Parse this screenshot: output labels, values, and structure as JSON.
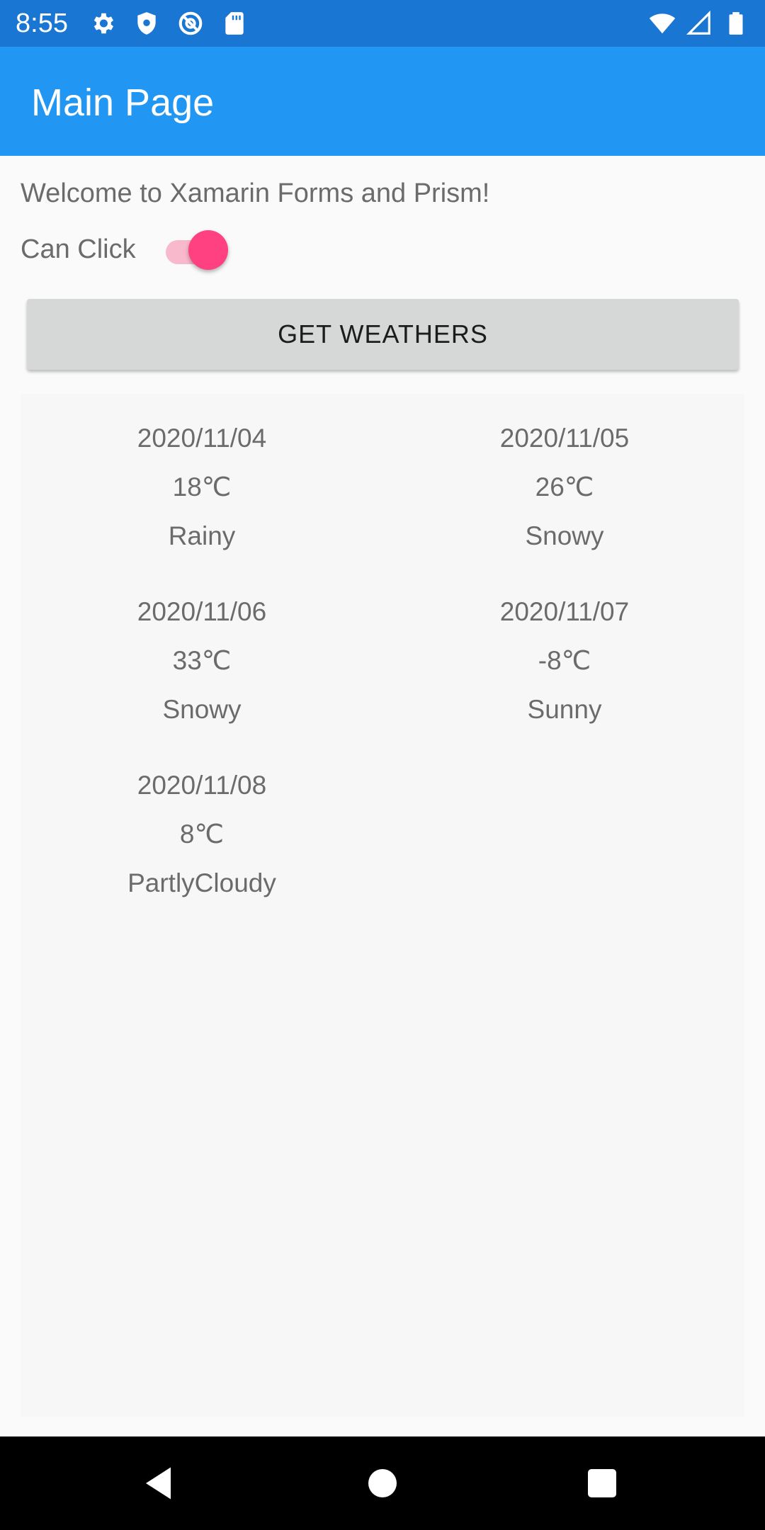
{
  "status_bar": {
    "time": "8:55",
    "left_icons": [
      "gear-icon",
      "shield-icon",
      "at-sign-icon",
      "sd-card-icon"
    ],
    "right_icons": [
      "wifi-icon",
      "cell-signal-icon",
      "battery-icon"
    ]
  },
  "app_bar": {
    "title": "Main Page",
    "color": "#2196f3"
  },
  "main": {
    "welcome_text": "Welcome to Xamarin Forms and Prism!",
    "can_click_label": "Can Click",
    "can_click_switch_on": true,
    "get_button_label": "GET WEATHERS",
    "accent_color": "#ff4081"
  },
  "weathers": [
    {
      "date": "2020/11/04",
      "temperature": "18℃",
      "condition": "Rainy"
    },
    {
      "date": "2020/11/05",
      "temperature": "26℃",
      "condition": "Snowy"
    },
    {
      "date": "2020/11/06",
      "temperature": "33℃",
      "condition": "Snowy"
    },
    {
      "date": "2020/11/07",
      "temperature": "-8℃",
      "condition": "Sunny"
    },
    {
      "date": "2020/11/08",
      "temperature": "8℃",
      "condition": "PartlyCloudy"
    }
  ],
  "nav_bar": {
    "buttons": [
      "back-icon",
      "home-icon",
      "recents-icon"
    ]
  }
}
